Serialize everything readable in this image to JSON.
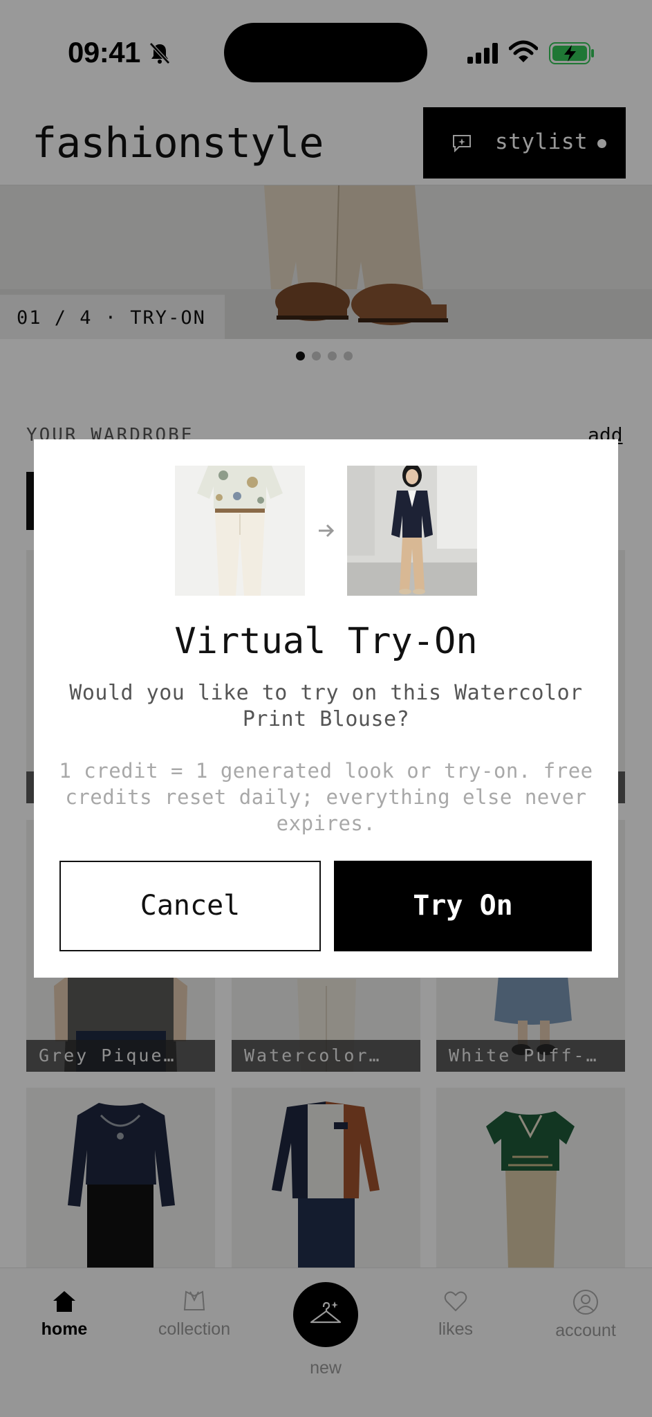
{
  "status_bar": {
    "time": "09:41"
  },
  "header": {
    "logo": "fashionstyle",
    "stylist_label": "stylist"
  },
  "hero": {
    "caption": "01 / 4 · TRY-ON",
    "slide_index": 1,
    "slide_count": 4
  },
  "wardrobe": {
    "title": "YOUR WARDROBE",
    "add_label": "add",
    "items": [
      {
        "label": "Grey Pique…"
      },
      {
        "label": "Watercolor…"
      },
      {
        "label": "White Puff-…"
      }
    ]
  },
  "bottom_nav": {
    "items": [
      {
        "label": "home",
        "icon": "home-icon",
        "active": true
      },
      {
        "label": "collection",
        "icon": "collection-icon"
      },
      {
        "label": "new",
        "icon": "hanger-icon"
      },
      {
        "label": "likes",
        "icon": "heart-icon"
      },
      {
        "label": "account",
        "icon": "account-icon"
      }
    ]
  },
  "modal": {
    "title": "Virtual Try-On",
    "question": "Would you like to try on this Watercolor Print Blouse?",
    "note": "1 credit = 1 generated look or try-on. free credits reset daily; everything else never expires.",
    "cancel_label": "Cancel",
    "confirm_label": "Try On"
  },
  "colors": {
    "primary": "#000000",
    "surface": "#ffffff",
    "muted_text": "#999999",
    "battery_green": "#34c759"
  }
}
